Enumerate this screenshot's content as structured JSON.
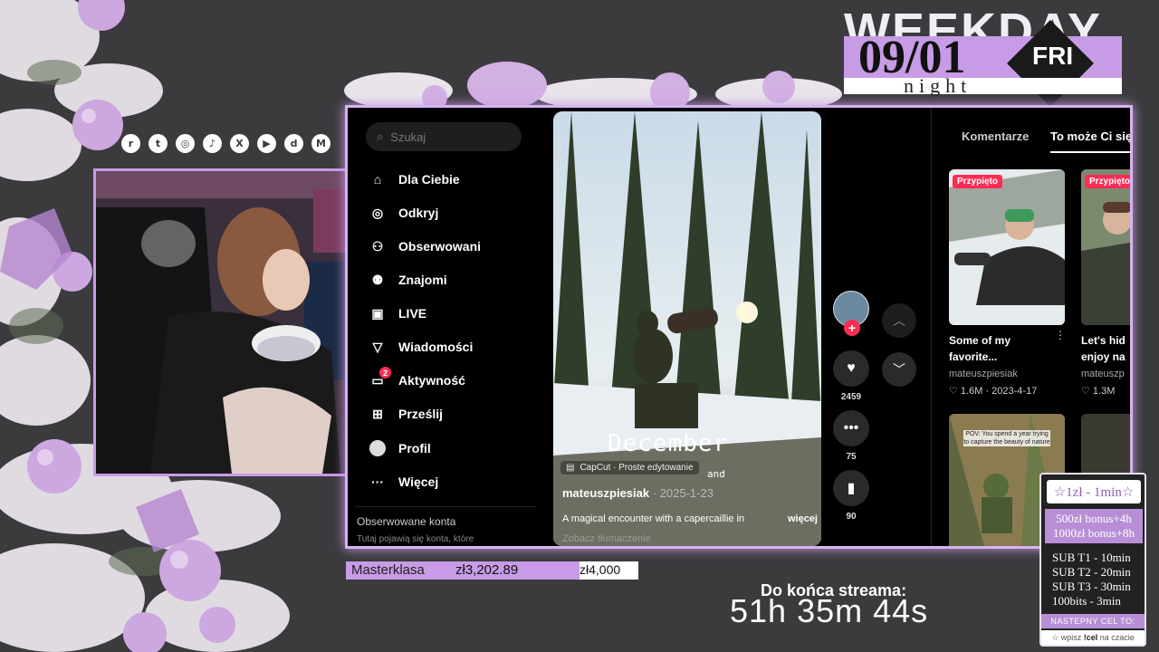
{
  "header": {
    "weekday_word": "WEEKDAY",
    "date": "09/01",
    "day_of_week": "FRI",
    "time_of_day": "night"
  },
  "socials": [
    "reddit-icon",
    "twitch-icon",
    "instagram-icon",
    "tiktok-icon",
    "x-icon",
    "youtube-icon",
    "discord-icon",
    "gmail-icon"
  ],
  "sidebar": {
    "search_placeholder": "Szukaj",
    "items": [
      {
        "label": "Dla Ciebie",
        "icon": "home-icon"
      },
      {
        "label": "Odkryj",
        "icon": "compass-icon"
      },
      {
        "label": "Obserwowani",
        "icon": "following-icon"
      },
      {
        "label": "Znajomi",
        "icon": "friends-icon"
      },
      {
        "label": "LIVE",
        "icon": "live-icon"
      },
      {
        "label": "Wiadomości",
        "icon": "messages-icon"
      },
      {
        "label": "Aktywność",
        "icon": "activity-icon",
        "badge": "2"
      },
      {
        "label": "Prześlij",
        "icon": "upload-icon"
      },
      {
        "label": "Profil",
        "icon": "profile-icon"
      },
      {
        "label": "Więcej",
        "icon": "more-icon"
      }
    ],
    "followed_title": "Obserwowane konta",
    "followed_sub": "Tutaj pojawią się konta, które"
  },
  "video": {
    "capcut": "CapCut · Proste edytowanie",
    "overlay_title": "December",
    "overlay_and": "and",
    "author": "mateuszpiesiak",
    "date": " · 2025-1-23",
    "description": "A magical encounter with a capercaillie in",
    "more": "więcej",
    "translate": "Zobacz tłumaczenie",
    "likes": "2459",
    "comments": "75",
    "saves": "90"
  },
  "panel": {
    "tab_comments": "Komentarze",
    "tab_related": "To może Ci się",
    "cards": [
      {
        "pinned": "Przypięto",
        "caption_1": "Some of my",
        "caption_2": "favorite...",
        "author": "mateuszpiesiak",
        "likes": "1.6M",
        "date": "2023-4-17"
      },
      {
        "pinned": "Przypięto",
        "caption_1": "Let's hid",
        "caption_2": "enjoy na",
        "author": "mateuszp",
        "likes": "1.3M",
        "date": ""
      }
    ],
    "thumb3_text": "POV: You spend a year trying to capture the beauty of nature"
  },
  "goal": {
    "name": "Masterklasa",
    "current": "zł3,202.89",
    "target": "zł4,000",
    "progress": 0.8
  },
  "countdown": {
    "label": "Do końca streama:",
    "time": "51h 35m 44s"
  },
  "subathon": {
    "rate": "☆1zł - 1min☆",
    "bonus_1": "500zł bonus+4h",
    "bonus_2": "1000zł bonus+8h",
    "lines": [
      "SUB T1 - 10min",
      "SUB T2 - 20min",
      "SUB T3 - 30min",
      "100bits - 3min"
    ],
    "next_goal": "NASTEPNY CEL TO:",
    "cmd_prefix": "☆ wpisz ",
    "cmd": "!cel",
    "cmd_suffix": " na czacie"
  },
  "colors": {
    "accent": "#c79be6",
    "tiktok_red": "#fe2c55",
    "background": "#3b3a3d"
  }
}
